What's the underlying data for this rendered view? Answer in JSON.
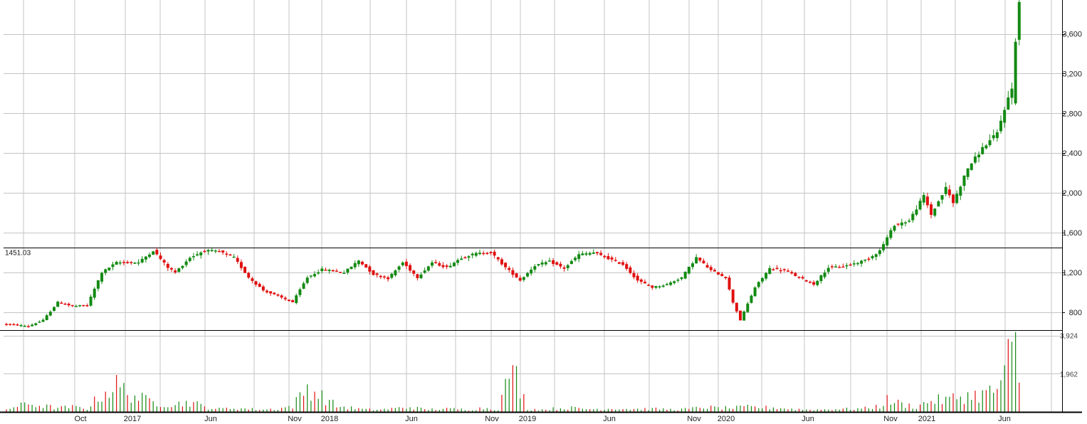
{
  "chart_data": {
    "type": "candlestick",
    "x_tick_labels": [
      "Oct",
      "2017",
      "Jun",
      "Nov",
      "2018",
      "Jun",
      "Nov",
      "2019",
      "Jun",
      "Nov",
      "2020",
      "Jun",
      "Nov",
      "2021",
      "Jun"
    ],
    "y_ticks": [
      800,
      1200,
      1600,
      2000,
      2400,
      2800,
      3200,
      3600
    ],
    "y_tick_labels": [
      "800",
      "1,200",
      "1,600",
      "2,000",
      "2,400",
      "2,800",
      "3,200",
      "3,600"
    ],
    "ylim": [
      620,
      3940
    ],
    "reference_line": {
      "value": 1451.03,
      "label": "1451.03"
    },
    "volume": {
      "ticks": [
        1962,
        3924
      ],
      "tick_labels": [
        "1,962",
        "3,924"
      ],
      "ylim": [
        0,
        4200
      ]
    },
    "up_color": "#138a13",
    "down_color": "#e01010",
    "grid": true,
    "anchors": [
      [
        0,
        680
      ],
      [
        6,
        660
      ],
      [
        10,
        720
      ],
      [
        14,
        900
      ],
      [
        18,
        860
      ],
      [
        22,
        870
      ],
      [
        26,
        1200
      ],
      [
        30,
        1300
      ],
      [
        36,
        1300
      ],
      [
        40,
        1420
      ],
      [
        44,
        1250
      ],
      [
        46,
        1200
      ],
      [
        50,
        1350
      ],
      [
        54,
        1420
      ],
      [
        58,
        1410
      ],
      [
        62,
        1350
      ],
      [
        66,
        1150
      ],
      [
        70,
        1020
      ],
      [
        74,
        960
      ],
      [
        78,
        900
      ],
      [
        82,
        1150
      ],
      [
        86,
        1230
      ],
      [
        92,
        1200
      ],
      [
        96,
        1320
      ],
      [
        100,
        1180
      ],
      [
        104,
        1140
      ],
      [
        108,
        1300
      ],
      [
        112,
        1150
      ],
      [
        116,
        1300
      ],
      [
        120,
        1250
      ],
      [
        124,
        1350
      ],
      [
        128,
        1390
      ],
      [
        132,
        1400
      ],
      [
        136,
        1250
      ],
      [
        140,
        1120
      ],
      [
        144,
        1270
      ],
      [
        148,
        1310
      ],
      [
        152,
        1240
      ],
      [
        156,
        1380
      ],
      [
        160,
        1400
      ],
      [
        164,
        1340
      ],
      [
        168,
        1280
      ],
      [
        172,
        1120
      ],
      [
        176,
        1050
      ],
      [
        180,
        1080
      ],
      [
        184,
        1150
      ],
      [
        188,
        1350
      ],
      [
        192,
        1220
      ],
      [
        196,
        1150
      ],
      [
        198,
        900
      ],
      [
        200,
        720
      ],
      [
        204,
        1050
      ],
      [
        208,
        1240
      ],
      [
        212,
        1220
      ],
      [
        216,
        1150
      ],
      [
        220,
        1080
      ],
      [
        224,
        1250
      ],
      [
        228,
        1260
      ],
      [
        232,
        1300
      ],
      [
        235,
        1340
      ],
      [
        238,
        1420
      ],
      [
        242,
        1680
      ],
      [
        246,
        1720
      ],
      [
        250,
        1970
      ],
      [
        252,
        1780
      ],
      [
        256,
        2050
      ],
      [
        258,
        1900
      ],
      [
        262,
        2250
      ],
      [
        266,
        2450
      ],
      [
        270,
        2600
      ],
      [
        272,
        2850
      ],
      [
        274,
        3050
      ],
      [
        275,
        3500
      ],
      [
        276,
        3920
      ]
    ],
    "volume_anchors": [
      [
        0,
        150
      ],
      [
        6,
        420
      ],
      [
        10,
        300
      ],
      [
        14,
        200
      ],
      [
        18,
        250
      ],
      [
        22,
        180
      ],
      [
        26,
        900
      ],
      [
        30,
        1350
      ],
      [
        34,
        900
      ],
      [
        38,
        600
      ],
      [
        42,
        450
      ],
      [
        46,
        380
      ],
      [
        50,
        520
      ],
      [
        54,
        250
      ],
      [
        58,
        150
      ],
      [
        62,
        200
      ],
      [
        66,
        150
      ],
      [
        70,
        120
      ],
      [
        74,
        160
      ],
      [
        78,
        300
      ],
      [
        82,
        1250
      ],
      [
        86,
        800
      ],
      [
        90,
        300
      ],
      [
        94,
        200
      ],
      [
        98,
        120
      ],
      [
        102,
        120
      ],
      [
        106,
        180
      ],
      [
        110,
        250
      ],
      [
        114,
        120
      ],
      [
        118,
        150
      ],
      [
        122,
        150
      ],
      [
        126,
        120
      ],
      [
        130,
        200
      ],
      [
        134,
        150
      ],
      [
        138,
        2400
      ],
      [
        142,
        150
      ],
      [
        146,
        120
      ],
      [
        150,
        180
      ],
      [
        154,
        200
      ],
      [
        158,
        150
      ],
      [
        162,
        150
      ],
      [
        166,
        180
      ],
      [
        170,
        150
      ],
      [
        174,
        150
      ],
      [
        178,
        150
      ],
      [
        182,
        120
      ],
      [
        186,
        150
      ],
      [
        190,
        250
      ],
      [
        194,
        200
      ],
      [
        198,
        200
      ],
      [
        202,
        250
      ],
      [
        206,
        220
      ],
      [
        210,
        220
      ],
      [
        214,
        150
      ],
      [
        218,
        120
      ],
      [
        222,
        120
      ],
      [
        226,
        150
      ],
      [
        230,
        150
      ],
      [
        234,
        180
      ],
      [
        238,
        300
      ],
      [
        240,
        600
      ],
      [
        244,
        400
      ],
      [
        248,
        250
      ],
      [
        252,
        600
      ],
      [
        256,
        600
      ],
      [
        260,
        800
      ],
      [
        264,
        850
      ],
      [
        268,
        1000
      ],
      [
        270,
        1200
      ],
      [
        272,
        1800
      ],
      [
        274,
        3600
      ],
      [
        275,
        4100
      ],
      [
        276,
        1500
      ]
    ]
  }
}
